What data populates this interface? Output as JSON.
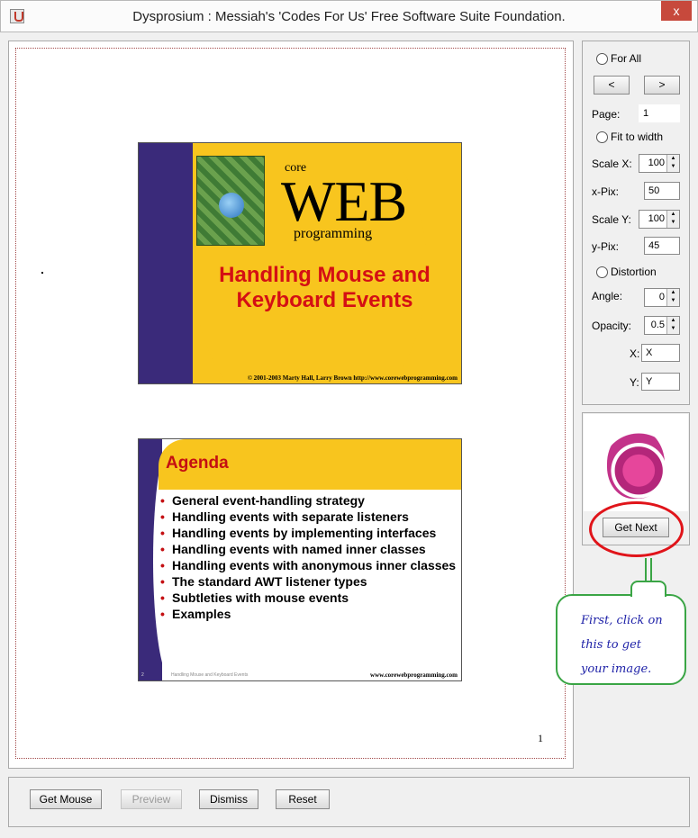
{
  "window": {
    "title": "Dysprosium : Messiah's 'Codes For Us' Free Software Suite Foundation.",
    "close_glyph": "x"
  },
  "page": {
    "page_number": "1",
    "slide1": {
      "core": "core",
      "web": "WEB",
      "programming": "programming",
      "title_line1": "Handling Mouse and",
      "title_line2": "Keyboard Events",
      "footer": "© 2001-2003 Marty Hall, Larry Brown http://www.corewebprogramming.com"
    },
    "slide2": {
      "title": "Agenda",
      "items": [
        "General event-handling strategy",
        "Handling events with separate listeners",
        "Handling events by implementing interfaces",
        "Handling events with named inner classes",
        "Handling events with anonymous inner classes",
        "The standard AWT listener types",
        "Subtleties with mouse events",
        "Examples"
      ],
      "slide_number": "2",
      "small_caption": "Handling Mouse and Keyboard Events",
      "footer": "www.corewebprogramming.com"
    }
  },
  "controls": {
    "for_all": "For All",
    "prev": "<",
    "next": ">",
    "page_label": "Page:",
    "page_value": "1",
    "fit_to_width": "Fit to width",
    "scale_x_label": "Scale X:",
    "scale_x_value": "100",
    "x_pix_label": "x-Pix:",
    "x_pix_value": "50",
    "scale_y_label": "Scale Y:",
    "scale_y_value": "100",
    "y_pix_label": "y-Pix:",
    "y_pix_value": "45",
    "distortion": "Distortion",
    "angle_label": "Angle:",
    "angle_value": "0",
    "opacity_label": "Opacity:",
    "opacity_value": "0.5",
    "x_label": "X:",
    "x_value": "X",
    "y_label": "Y:",
    "y_value": "Y"
  },
  "logo_panel": {
    "get_next": "Get Next"
  },
  "callout": {
    "line1": "First, click on",
    "line2": "this to get",
    "line3": "your image."
  },
  "bottom": {
    "get_mouse": "Get Mouse",
    "preview": "Preview",
    "dismiss": "Dismiss",
    "reset": "Reset"
  },
  "colors": {
    "accent_red": "#e0141a",
    "callout_green": "#3aa545",
    "callout_text": "#1f22a8"
  }
}
